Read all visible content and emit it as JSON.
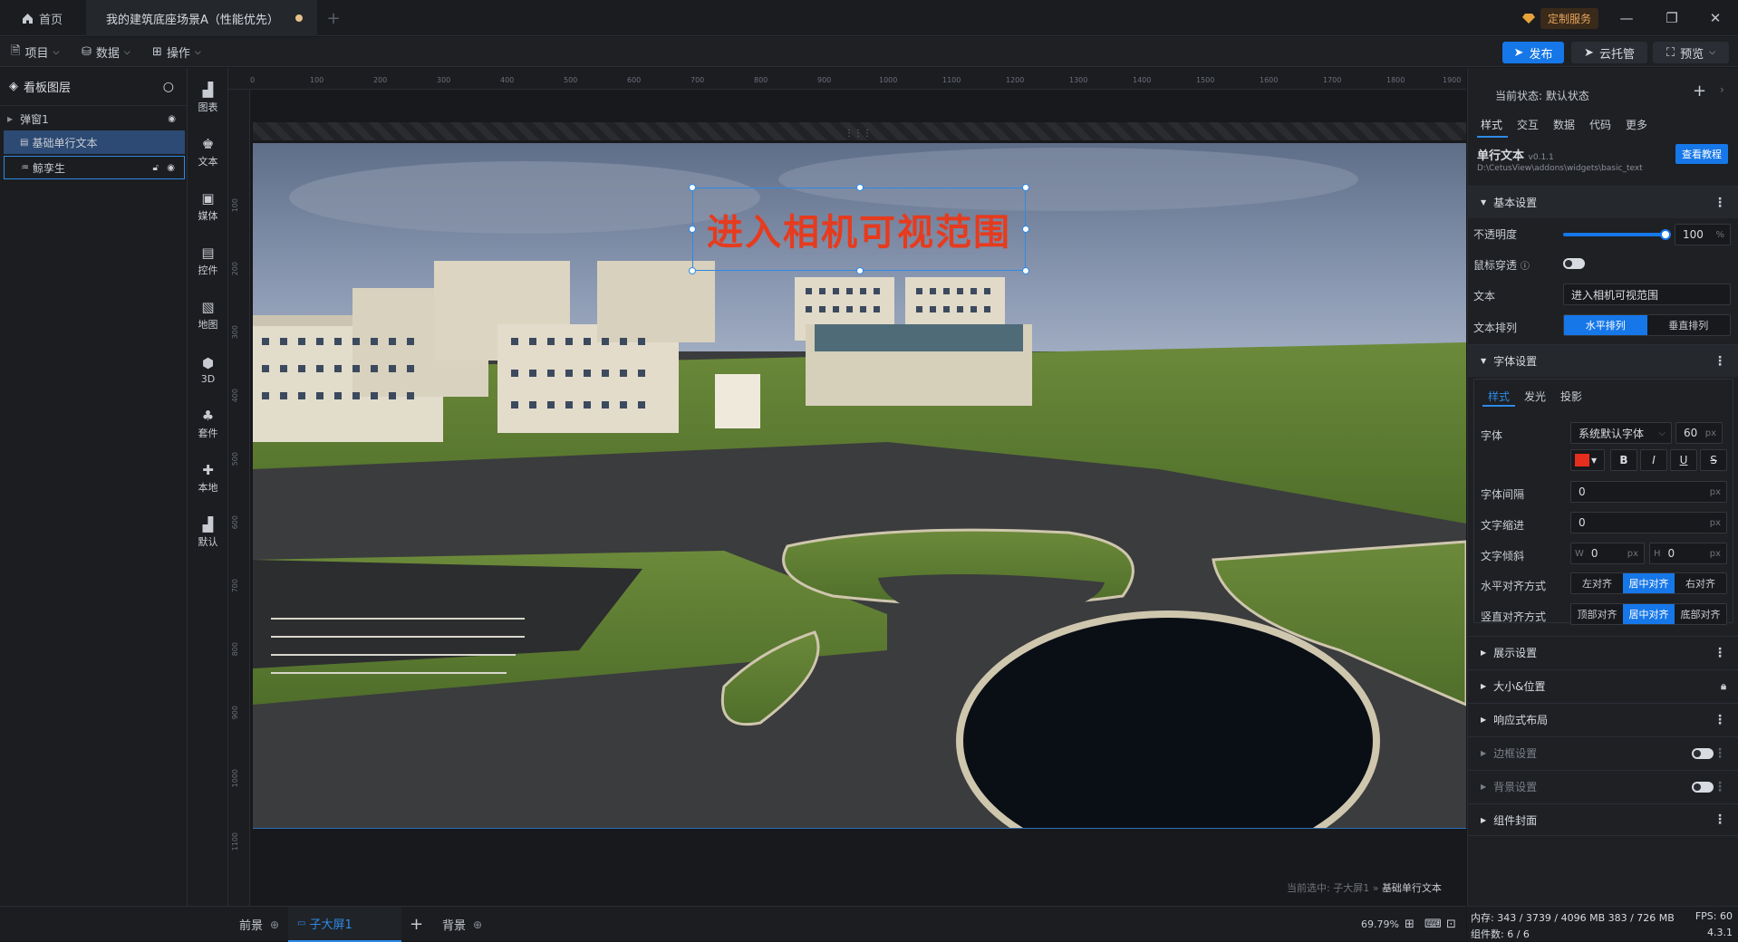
{
  "tabs": {
    "home": "首页",
    "active": "我的建筑底座场景A（性能优先）",
    "add": "+"
  },
  "topright": {
    "custom_service": "定制服务"
  },
  "menu": {
    "project": "项目",
    "data": "数据",
    "operate": "操作"
  },
  "actions": {
    "publish": "发布",
    "cloud": "云托管",
    "preview": "预览"
  },
  "layers": {
    "title": "看板图层",
    "items": [
      {
        "label": "弹窗1"
      },
      {
        "label": "基础单行文本"
      },
      {
        "label": "鲸孪生"
      }
    ]
  },
  "iconbar": [
    {
      "label": "图表",
      "icon": "bar-chart-icon"
    },
    {
      "label": "文本",
      "icon": "text-icon"
    },
    {
      "label": "媒体",
      "icon": "media-icon"
    },
    {
      "label": "控件",
      "icon": "control-icon"
    },
    {
      "label": "地图",
      "icon": "map-icon"
    },
    {
      "label": "3D",
      "icon": "cube-icon"
    },
    {
      "label": "套件",
      "icon": "kit-icon"
    },
    {
      "label": "本地",
      "icon": "puzzle-icon"
    },
    {
      "label": "默认",
      "icon": "default-icon"
    }
  ],
  "ruler": {
    "top": [
      "0",
      "100",
      "200",
      "300",
      "400",
      "500",
      "600",
      "700",
      "800",
      "900",
      "1000",
      "1100",
      "1200",
      "1300",
      "1400",
      "1500",
      "1600",
      "1700",
      "1800",
      "1900"
    ],
    "left": [
      "100",
      "200",
      "300",
      "400",
      "500",
      "600",
      "700",
      "800",
      "900",
      "1000",
      "1100"
    ]
  },
  "canvas": {
    "selected_text": "进入相机可视范围",
    "status_prefix": "当前选中: 子大屏1 »",
    "status_item": "基础单行文本"
  },
  "bottom": {
    "front": "前景",
    "screen": "子大屏1",
    "add": "+",
    "back": "背景",
    "zoom": "69.79%"
  },
  "right": {
    "state_label": "当前状态: 默认状态",
    "tabs": [
      "样式",
      "交互",
      "数据",
      "代码",
      "更多"
    ],
    "widget_name": "单行文本",
    "widget_version": "v0.1.1",
    "tutorial": "查看教程",
    "widget_path": "D:\\CetusView\\addons\\widgets\\basic_text",
    "basic_settings": "基本设置",
    "opacity_label": "不透明度",
    "opacity_value": "100",
    "opacity_unit": "%",
    "opacity": 1.0,
    "mouse_through": "鼠标穿透",
    "text_label": "文本",
    "text_value": "进入相机可视范围",
    "arrange_label": "文本排列",
    "arrange_h": "水平排列",
    "arrange_v": "垂直排列",
    "font_settings": "字体设置",
    "font_tabs": [
      "样式",
      "发光",
      "投影"
    ],
    "font_label": "字体",
    "font_value": "系统默认字体",
    "font_size": "60",
    "px": "px",
    "font_color": "#e62e1e",
    "bold": "B",
    "italic": "I",
    "underline": "U",
    "strike": "S",
    "letter_spacing_label": "字体间隔",
    "letter_spacing": "0",
    "indent_label": "文字缩进",
    "indent": "0",
    "skew_label": "文字倾斜",
    "skew_w_label": "W",
    "skew_w": "0",
    "skew_h_label": "H",
    "skew_h": "0",
    "halign_label": "水平对齐方式",
    "halign": [
      "左对齐",
      "居中对齐",
      "右对齐"
    ],
    "valign_label": "竖直对齐方式",
    "valign": [
      "顶部对齐",
      "居中对齐",
      "底部对齐"
    ],
    "sections": [
      "展示设置",
      "大小&位置",
      "响应式布局",
      "边框设置",
      "背景设置",
      "组件封面"
    ]
  },
  "footer": {
    "mem": "内存: 343 / 3739 / 4096 MB 383 / 726 MB",
    "fps": "FPS: 60",
    "count": "组件数: 6 / 6",
    "version": "4.3.1"
  }
}
